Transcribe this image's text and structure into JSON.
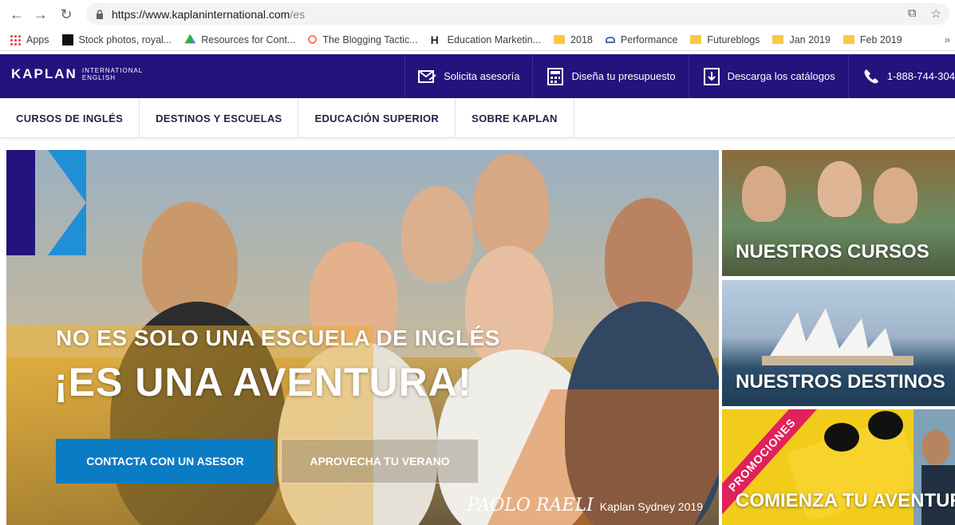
{
  "browser": {
    "url_host": "https://www.kaplaninternational.com",
    "url_path": "/es",
    "bookmarks": [
      {
        "label": "Apps",
        "icon": "apps-grid-icon"
      },
      {
        "label": "Stock photos, royal...",
        "icon": "istock-icon"
      },
      {
        "label": "Resources for Cont...",
        "icon": "drive-icon"
      },
      {
        "label": "The Blogging Tactic...",
        "icon": "hubspot-icon"
      },
      {
        "label": "Education Marketin...",
        "icon": "h-icon"
      },
      {
        "label": "2018",
        "icon": "folder-icon"
      },
      {
        "label": "Performance",
        "icon": "performance-icon"
      },
      {
        "label": "Futureblogs",
        "icon": "folder-icon"
      },
      {
        "label": "Jan 2019",
        "icon": "folder-icon"
      },
      {
        "label": "Feb 2019",
        "icon": "folder-icon"
      }
    ]
  },
  "site": {
    "logo_main": "KAPLAN",
    "logo_sub_1": "INTERNATIONAL",
    "logo_sub_2": "ENGLISH",
    "top_links": [
      "Solicita asesoría",
      "Diseña tu presupuesto",
      "Descarga los catálogos",
      "1-888-744-304"
    ],
    "nav": [
      "CURSOS DE INGLÉS",
      "DESTINOS Y ESCUELAS",
      "EDUCACIÓN SUPERIOR",
      "SOBRE KAPLAN"
    ],
    "colors": {
      "brand_navy": "#23137c",
      "accent_blue": "#0a7cc4",
      "promo_pink": "#e2205b"
    }
  },
  "hero": {
    "subtitle": "NO ES SOLO UNA ESCUELA DE INGLÉS",
    "title": "¡ES UNA AVENTURA!",
    "cta_primary": "CONTACTA CON UN ASESOR",
    "cta_secondary": "APROVECHA TU VERANO",
    "credit_name": "PAOLO RAELI",
    "credit_text": "Kaplan Sydney 2019"
  },
  "tiles": {
    "t1": "NUESTROS CURSOS",
    "t2": "NUESTROS DESTINOS",
    "t3": "COMIENZA TU AVENTURA",
    "promo": "PROMOCIONES"
  }
}
